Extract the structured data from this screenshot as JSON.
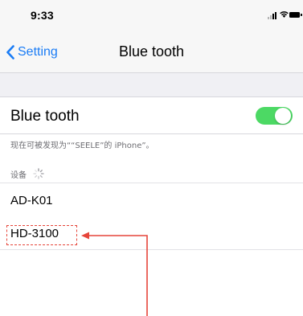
{
  "status_bar": {
    "time": "9:33"
  },
  "nav": {
    "back_label": "Setting",
    "title": "Blue tooth"
  },
  "bluetooth": {
    "label": "Blue tooth",
    "enabled": true
  },
  "discover_text": "现在可被发现为““SEELE”的 iPhone”。",
  "devices": {
    "header": "设备",
    "items": [
      {
        "name": "AD-K01"
      },
      {
        "name": "HD-3100"
      }
    ]
  },
  "colors": {
    "accent": "#1a7cf5",
    "toggle_on": "#4cd964",
    "annotation": "#e6453a"
  }
}
